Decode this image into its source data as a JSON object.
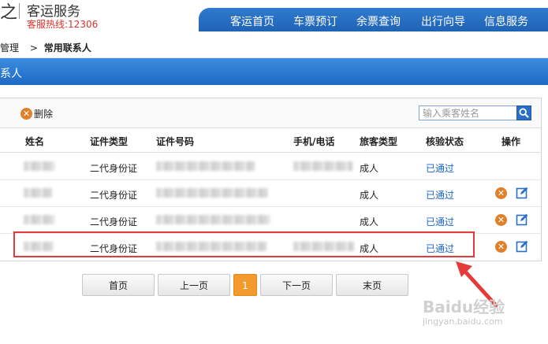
{
  "header": {
    "logo_glyph": "之",
    "brand": "客运服务",
    "hotline": "客服热线:12306",
    "nav": [
      "客运首页",
      "车票预订",
      "余票查询",
      "出行向导",
      "信息服务"
    ]
  },
  "breadcrumb": {
    "parent": "管理",
    "sep": ">",
    "current": "常用联系人"
  },
  "title": "系人",
  "toolbar": {
    "delete_label": "删除",
    "search_placeholder": "输入乘客姓名"
  },
  "table": {
    "headers": [
      "姓名",
      "证件类型",
      "证件号码",
      "手机/电话",
      "旅客类型",
      "核验状态",
      "操作"
    ],
    "rows": [
      {
        "id_type": "二代身份证",
        "passenger_type": "成人",
        "status": "已通过"
      },
      {
        "id_type": "二代身份证",
        "passenger_type": "成人",
        "status": "已通过"
      },
      {
        "id_type": "二代身份证",
        "passenger_type": "成人",
        "status": "已通过"
      },
      {
        "id_type": "二代身份证",
        "passenger_type": "成人",
        "status": "已通过"
      }
    ]
  },
  "pagination": {
    "first": "首页",
    "prev": "上一页",
    "current": "1",
    "next": "下一页",
    "last": "末页"
  },
  "watermark": {
    "main": "Baidu经验",
    "sub": "jingyan.baidu.com"
  },
  "colors": {
    "nav_blue": "#2f7bd0",
    "accent_orange": "#f29a2e",
    "highlight_red": "#e53a3a",
    "link_blue": "#1a66c9",
    "hotline_red": "#d9322b"
  }
}
